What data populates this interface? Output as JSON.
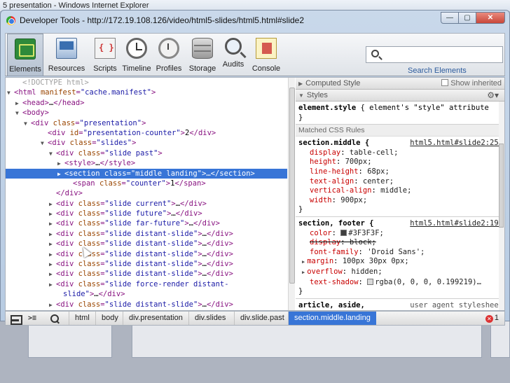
{
  "outer_window": {
    "title": "5 presentation - Windows Internet Explorer"
  },
  "window": {
    "title": "Developer Tools - http://172.19.108.126/video/html5-slides/html5.html#slide2",
    "controls": {
      "minimize": "—",
      "maximize": "▢",
      "close": "✕"
    }
  },
  "toolbar": {
    "buttons": [
      {
        "label": "Elements",
        "icon": "elements-icon",
        "active": true
      },
      {
        "label": "Resources",
        "icon": "resources-icon"
      },
      {
        "label": "Scripts",
        "icon": "scripts-icon"
      },
      {
        "label": "Timeline",
        "icon": "timeline-icon"
      },
      {
        "label": "Profiles",
        "icon": "profiles-icon"
      },
      {
        "label": "Storage",
        "icon": "storage-icon"
      },
      {
        "label": "Audits",
        "icon": "audits-icon"
      },
      {
        "label": "Console",
        "icon": "console-icon"
      }
    ],
    "search": {
      "value": "",
      "label": "Search Elements"
    }
  },
  "dom": {
    "lines": [
      {
        "tri": "",
        "segs": [
          [
            "cm",
            "<!DOCTYPE html>"
          ]
        ]
      },
      {
        "tri": "▼",
        "segs": [
          [
            "t",
            "<html "
          ],
          [
            "a",
            "manifest"
          ],
          [
            "t",
            "="
          ],
          [
            "v",
            "\"cache.manifest\""
          ],
          [
            "t",
            ">"
          ]
        ]
      },
      {
        "tri": "▶",
        "segs": [
          [
            "t",
            "<head>"
          ],
          [
            "x",
            "…"
          ],
          [
            "t",
            "</head>"
          ]
        ]
      },
      {
        "tri": "▼",
        "segs": [
          [
            "t",
            "<body>"
          ]
        ]
      },
      {
        "tri": "▼",
        "segs": [
          [
            "t",
            "<div "
          ],
          [
            "a",
            "class"
          ],
          [
            "t",
            "="
          ],
          [
            "v",
            "\"presentation\""
          ],
          [
            "t",
            ">"
          ]
        ]
      },
      {
        "tri": "",
        "segs": [
          [
            "t",
            "<div "
          ],
          [
            "a",
            "id"
          ],
          [
            "t",
            "="
          ],
          [
            "v",
            "\"presentation-counter\""
          ],
          [
            "t",
            ">"
          ],
          [
            "x",
            "2"
          ],
          [
            "t",
            "</div>"
          ]
        ]
      },
      {
        "tri": "▼",
        "segs": [
          [
            "t",
            "<div "
          ],
          [
            "a",
            "class"
          ],
          [
            "t",
            "="
          ],
          [
            "v",
            "\"slides\""
          ],
          [
            "t",
            ">"
          ]
        ]
      },
      {
        "tri": "▼",
        "segs": [
          [
            "t",
            "<div "
          ],
          [
            "a",
            "class"
          ],
          [
            "t",
            "="
          ],
          [
            "v",
            "\"slide past\""
          ],
          [
            "t",
            ">"
          ]
        ]
      },
      {
        "tri": "▶",
        "segs": [
          [
            "t",
            "<style>"
          ],
          [
            "x",
            "…"
          ],
          [
            "t",
            "</style>"
          ]
        ]
      },
      {
        "tri": "▶",
        "sel": true,
        "segs": [
          [
            "t",
            "<section "
          ],
          [
            "a",
            "class"
          ],
          [
            "t",
            "="
          ],
          [
            "v",
            "\"middle landing\""
          ],
          [
            "t",
            ">"
          ],
          [
            "x",
            "…"
          ],
          [
            "t",
            "</section>"
          ]
        ]
      },
      {
        "tri": "",
        "segs": [
          [
            "t",
            "<span "
          ],
          [
            "a",
            "class"
          ],
          [
            "t",
            "="
          ],
          [
            "v",
            "\"counter\""
          ],
          [
            "t",
            ">"
          ],
          [
            "x",
            "1"
          ],
          [
            "t",
            "</span>"
          ]
        ]
      },
      {
        "tri": "",
        "segs": [
          [
            "t",
            "</div>"
          ]
        ]
      },
      {
        "tri": "▶",
        "segs": [
          [
            "t",
            "<div "
          ],
          [
            "a",
            "class"
          ],
          [
            "t",
            "="
          ],
          [
            "v",
            "\"slide current\""
          ],
          [
            "t",
            ">"
          ],
          [
            "x",
            "…"
          ],
          [
            "t",
            "</div>"
          ]
        ]
      },
      {
        "tri": "▶",
        "segs": [
          [
            "t",
            "<div "
          ],
          [
            "a",
            "class"
          ],
          [
            "t",
            "="
          ],
          [
            "v",
            "\"slide future\""
          ],
          [
            "t",
            ">"
          ],
          [
            "x",
            "…"
          ],
          [
            "t",
            "</div>"
          ]
        ]
      },
      {
        "tri": "▶",
        "segs": [
          [
            "t",
            "<div "
          ],
          [
            "a",
            "class"
          ],
          [
            "t",
            "="
          ],
          [
            "v",
            "\"slide far-future\""
          ],
          [
            "t",
            ">"
          ],
          [
            "x",
            "…"
          ],
          [
            "t",
            "</div>"
          ]
        ]
      },
      {
        "tri": "▶",
        "segs": [
          [
            "t",
            "<div "
          ],
          [
            "a",
            "class"
          ],
          [
            "t",
            "="
          ],
          [
            "v",
            "\"slide distant-slide\""
          ],
          [
            "t",
            ">"
          ],
          [
            "x",
            "…"
          ],
          [
            "t",
            "</div>"
          ]
        ]
      },
      {
        "tri": "▶",
        "segs": [
          [
            "t",
            "<div "
          ],
          [
            "a",
            "class"
          ],
          [
            "t",
            "="
          ],
          [
            "v",
            "\"slide distant-slide\""
          ],
          [
            "t",
            ">"
          ],
          [
            "x",
            "…"
          ],
          [
            "t",
            "</div>"
          ]
        ]
      },
      {
        "tri": "▶",
        "segs": [
          [
            "t",
            "<div "
          ],
          [
            "a",
            "class"
          ],
          [
            "t",
            "="
          ],
          [
            "v",
            "\"slide distant-slide\""
          ],
          [
            "t",
            ">"
          ],
          [
            "x",
            "…"
          ],
          [
            "t",
            "</div>"
          ]
        ]
      },
      {
        "tri": "▶",
        "segs": [
          [
            "t",
            "<div "
          ],
          [
            "a",
            "class"
          ],
          [
            "t",
            "="
          ],
          [
            "v",
            "\"slide distant-slide\""
          ],
          [
            "t",
            ">"
          ],
          [
            "x",
            "…"
          ],
          [
            "t",
            "</div>"
          ]
        ]
      },
      {
        "tri": "▶",
        "segs": [
          [
            "t",
            "<div "
          ],
          [
            "a",
            "class"
          ],
          [
            "t",
            "="
          ],
          [
            "v",
            "\"slide distant-slide\""
          ],
          [
            "t",
            ">"
          ],
          [
            "x",
            "…"
          ],
          [
            "t",
            "</div>"
          ]
        ]
      },
      {
        "tri": "▶",
        "segs": [
          [
            "t",
            "<div "
          ],
          [
            "a",
            "class"
          ],
          [
            "t",
            "="
          ],
          [
            "v",
            "\"slide force-render distant-"
          ]
        ]
      },
      {
        "tri": "",
        "segs": [
          [
            "v",
            "slide\""
          ],
          [
            "t",
            ">"
          ],
          [
            "x",
            "…"
          ],
          [
            "t",
            "</div>"
          ]
        ]
      },
      {
        "tri": "▶",
        "segs": [
          [
            "t",
            "<div "
          ],
          [
            "a",
            "class"
          ],
          [
            "t",
            "="
          ],
          [
            "v",
            "\"slide distant-slide\""
          ],
          [
            "t",
            ">"
          ],
          [
            "x",
            "…"
          ],
          [
            "t",
            "</div>"
          ]
        ]
      }
    ]
  },
  "styles": {
    "computed_header": "Computed Style",
    "show_inherited": "Show inherited",
    "styles_header": "Styles",
    "element_style": {
      "selector": "element.style",
      "body": " { element's \"style\" attribute",
      "close": "}"
    },
    "matched_label": "Matched CSS Rules",
    "rules": [
      {
        "selector": "section.middle {",
        "source": "html5.html#slide2:256",
        "props": [
          {
            "name": "display",
            "value": "table-cell;"
          },
          {
            "name": "height",
            "value": "700px;"
          },
          {
            "name": "line-height",
            "value": "68px;"
          },
          {
            "name": "text-align",
            "value": "center;"
          },
          {
            "name": "vertical-align",
            "value": "middle;"
          },
          {
            "name": "width",
            "value": "900px;"
          }
        ]
      },
      {
        "selector": "section, footer {",
        "source": "html5.html#slide2:190",
        "props": [
          {
            "name": "color",
            "value": "#3F3F3F;",
            "swatch": "#3F3F3F"
          },
          {
            "name": "display",
            "value": "block;",
            "strike": true
          },
          {
            "name": "font-family",
            "value": "'Droid Sans';"
          },
          {
            "name": "margin",
            "value": "100px 30px 0px;",
            "expand": true
          },
          {
            "name": "overflow",
            "value": "hidden;",
            "expand": true
          },
          {
            "name": "text-shadow",
            "value": "rgba(0, 0, 0, 0.199219)…",
            "swatch": "#d9d9d9"
          }
        ]
      }
    ],
    "ua_rule": {
      "selector": "article, aside,",
      "source": "user agent stylesheet"
    }
  },
  "statusbar": {
    "crumbs": [
      "html",
      "body",
      "div.presentation",
      "div.slides",
      "div.slide.past",
      "section.middle.landing"
    ],
    "active_index": 5,
    "errors": "1"
  }
}
